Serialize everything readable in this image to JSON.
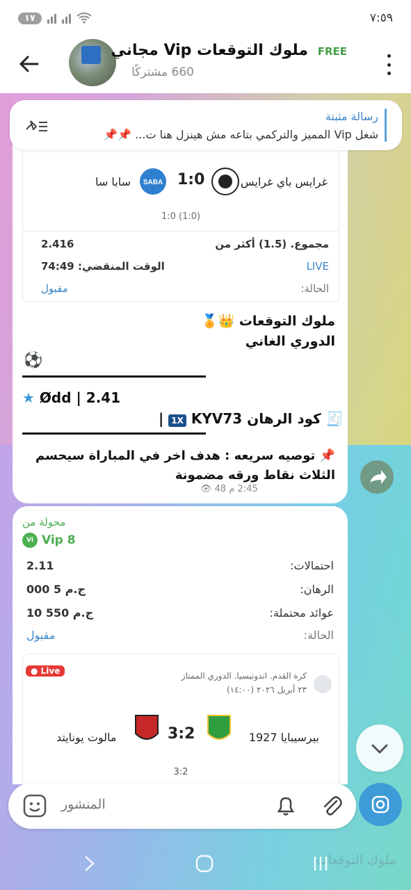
{
  "status_bar": {
    "time": "٧:٥٩",
    "notif_count": "١٧"
  },
  "header": {
    "channel_title": "ملوك التوقعات Vip مجاني",
    "badge": "FREE",
    "subscribers": "660 مشتركًا"
  },
  "pinned": {
    "title": "رسالة مثبتة",
    "text": "شغل  Vip المميز والتركمي بتاعه مش هينزل هنا ت..."
  },
  "message1": {
    "home_team": "غرايس باي غرايس",
    "away_team": "سابا سا",
    "score": "1:0",
    "sub_score": "1:0 (1:0)",
    "bet_type_label": "مجموع. (1.5) أكثر من",
    "bet_type_value": "2.416",
    "live_label": "LIVE",
    "time_label": "الوقت المنقضي: 74:49",
    "status_label": "الحالة:",
    "status_value": "مقبول",
    "line1": "ملوك التوقعات",
    "line2": "الدوري الغاني",
    "odds_text": "Ødd | 2.41",
    "code_label": "كود الرهان",
    "code_value": "KYV73 |",
    "tip": "توصيه سريعه : هدف اخر في المباراة سيحسم الثلاث نقاط ورقه مضمونة",
    "time": "2:45 م",
    "views": "48"
  },
  "message2": {
    "forwarded_from": "محولة من",
    "source_name": "Vip 8",
    "source_badge": "VI",
    "rows": [
      {
        "label": "احتمالات:",
        "value": "2.11"
      },
      {
        "label": "الرهان:",
        "value": "ج.م 5 000"
      },
      {
        "label": "عوائد محتملة:",
        "value": "ج.م 550 10"
      },
      {
        "label": "الحالة:",
        "value": "مقبول"
      }
    ],
    "match": {
      "live": "Live",
      "league": "كرة القدم. اندونيسيا. الدوري الممتاز",
      "date": "٢٣ أبريل ٢٠٢٦ (١٤:٠٠)",
      "home_team": "بيرسيبايا 1927",
      "away_team": "مالوت يونايتد",
      "score": "3:2",
      "sub_score": "3:2"
    }
  },
  "composer": {
    "placeholder": "المنشور"
  },
  "ghost_text": "ملوك التوقعات",
  "colors": {
    "accent": "#3d9bd7",
    "green": "#4caf50",
    "live_red": "#e53935"
  }
}
